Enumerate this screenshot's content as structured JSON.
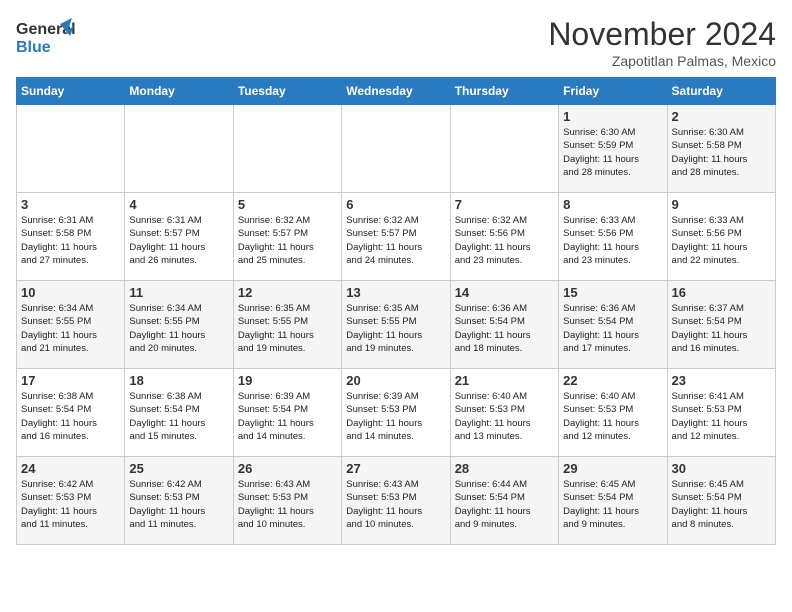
{
  "logo": {
    "line1": "General",
    "line2": "Blue"
  },
  "title": "November 2024",
  "subtitle": "Zapotitlan Palmas, Mexico",
  "days_of_week": [
    "Sunday",
    "Monday",
    "Tuesday",
    "Wednesday",
    "Thursday",
    "Friday",
    "Saturday"
  ],
  "weeks": [
    [
      {
        "day": "",
        "info": ""
      },
      {
        "day": "",
        "info": ""
      },
      {
        "day": "",
        "info": ""
      },
      {
        "day": "",
        "info": ""
      },
      {
        "day": "",
        "info": ""
      },
      {
        "day": "1",
        "info": "Sunrise: 6:30 AM\nSunset: 5:59 PM\nDaylight: 11 hours\nand 28 minutes."
      },
      {
        "day": "2",
        "info": "Sunrise: 6:30 AM\nSunset: 5:58 PM\nDaylight: 11 hours\nand 28 minutes."
      }
    ],
    [
      {
        "day": "3",
        "info": "Sunrise: 6:31 AM\nSunset: 5:58 PM\nDaylight: 11 hours\nand 27 minutes."
      },
      {
        "day": "4",
        "info": "Sunrise: 6:31 AM\nSunset: 5:57 PM\nDaylight: 11 hours\nand 26 minutes."
      },
      {
        "day": "5",
        "info": "Sunrise: 6:32 AM\nSunset: 5:57 PM\nDaylight: 11 hours\nand 25 minutes."
      },
      {
        "day": "6",
        "info": "Sunrise: 6:32 AM\nSunset: 5:57 PM\nDaylight: 11 hours\nand 24 minutes."
      },
      {
        "day": "7",
        "info": "Sunrise: 6:32 AM\nSunset: 5:56 PM\nDaylight: 11 hours\nand 23 minutes."
      },
      {
        "day": "8",
        "info": "Sunrise: 6:33 AM\nSunset: 5:56 PM\nDaylight: 11 hours\nand 23 minutes."
      },
      {
        "day": "9",
        "info": "Sunrise: 6:33 AM\nSunset: 5:56 PM\nDaylight: 11 hours\nand 22 minutes."
      }
    ],
    [
      {
        "day": "10",
        "info": "Sunrise: 6:34 AM\nSunset: 5:55 PM\nDaylight: 11 hours\nand 21 minutes."
      },
      {
        "day": "11",
        "info": "Sunrise: 6:34 AM\nSunset: 5:55 PM\nDaylight: 11 hours\nand 20 minutes."
      },
      {
        "day": "12",
        "info": "Sunrise: 6:35 AM\nSunset: 5:55 PM\nDaylight: 11 hours\nand 19 minutes."
      },
      {
        "day": "13",
        "info": "Sunrise: 6:35 AM\nSunset: 5:55 PM\nDaylight: 11 hours\nand 19 minutes."
      },
      {
        "day": "14",
        "info": "Sunrise: 6:36 AM\nSunset: 5:54 PM\nDaylight: 11 hours\nand 18 minutes."
      },
      {
        "day": "15",
        "info": "Sunrise: 6:36 AM\nSunset: 5:54 PM\nDaylight: 11 hours\nand 17 minutes."
      },
      {
        "day": "16",
        "info": "Sunrise: 6:37 AM\nSunset: 5:54 PM\nDaylight: 11 hours\nand 16 minutes."
      }
    ],
    [
      {
        "day": "17",
        "info": "Sunrise: 6:38 AM\nSunset: 5:54 PM\nDaylight: 11 hours\nand 16 minutes."
      },
      {
        "day": "18",
        "info": "Sunrise: 6:38 AM\nSunset: 5:54 PM\nDaylight: 11 hours\nand 15 minutes."
      },
      {
        "day": "19",
        "info": "Sunrise: 6:39 AM\nSunset: 5:54 PM\nDaylight: 11 hours\nand 14 minutes."
      },
      {
        "day": "20",
        "info": "Sunrise: 6:39 AM\nSunset: 5:53 PM\nDaylight: 11 hours\nand 14 minutes."
      },
      {
        "day": "21",
        "info": "Sunrise: 6:40 AM\nSunset: 5:53 PM\nDaylight: 11 hours\nand 13 minutes."
      },
      {
        "day": "22",
        "info": "Sunrise: 6:40 AM\nSunset: 5:53 PM\nDaylight: 11 hours\nand 12 minutes."
      },
      {
        "day": "23",
        "info": "Sunrise: 6:41 AM\nSunset: 5:53 PM\nDaylight: 11 hours\nand 12 minutes."
      }
    ],
    [
      {
        "day": "24",
        "info": "Sunrise: 6:42 AM\nSunset: 5:53 PM\nDaylight: 11 hours\nand 11 minutes."
      },
      {
        "day": "25",
        "info": "Sunrise: 6:42 AM\nSunset: 5:53 PM\nDaylight: 11 hours\nand 11 minutes."
      },
      {
        "day": "26",
        "info": "Sunrise: 6:43 AM\nSunset: 5:53 PM\nDaylight: 11 hours\nand 10 minutes."
      },
      {
        "day": "27",
        "info": "Sunrise: 6:43 AM\nSunset: 5:53 PM\nDaylight: 11 hours\nand 10 minutes."
      },
      {
        "day": "28",
        "info": "Sunrise: 6:44 AM\nSunset: 5:54 PM\nDaylight: 11 hours\nand 9 minutes."
      },
      {
        "day": "29",
        "info": "Sunrise: 6:45 AM\nSunset: 5:54 PM\nDaylight: 11 hours\nand 9 minutes."
      },
      {
        "day": "30",
        "info": "Sunrise: 6:45 AM\nSunset: 5:54 PM\nDaylight: 11 hours\nand 8 minutes."
      }
    ]
  ]
}
